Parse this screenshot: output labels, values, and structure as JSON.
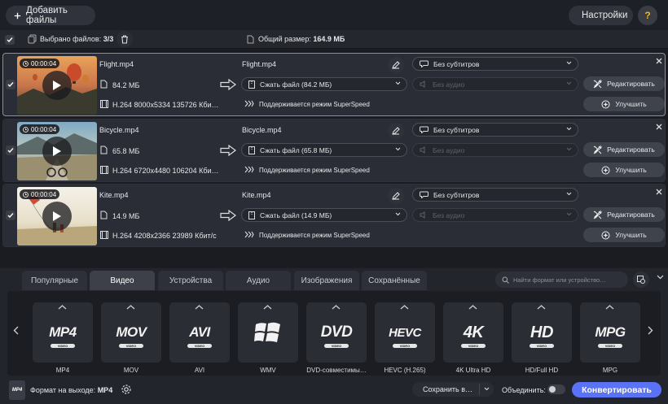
{
  "topbar": {
    "add_files_label": "Добавить файлы",
    "settings_label": "Настройки",
    "help_label": "?"
  },
  "selection": {
    "selected_label": "Выбрано файлов: ",
    "selected_count": "3/3",
    "total_label": "Общий размер: ",
    "total_size": "164.9 МБ"
  },
  "files": [
    {
      "duration": "00:00:04",
      "name": "Flight.mp4",
      "size": "84.2 МБ",
      "codec_info": "H.264 8000x5334 135726 Кби…",
      "output_name": "Flight.mp4",
      "compress": "Сжать файл (84.2 МБ)",
      "subtitles": "Без субтитров",
      "audio": "Без аудио",
      "superspeed": "Поддерживается режим SuperSpeed",
      "edit_label": "Редактировать",
      "enhance_label": "Улучшить"
    },
    {
      "duration": "00:00:04",
      "name": "Bicycle.mp4",
      "size": "65.8 МБ",
      "codec_info": "H.264 6720x4480 106204 Кби…",
      "output_name": "Bicycle.mp4",
      "compress": "Сжать файл (65.8 МБ)",
      "subtitles": "Без субтитров",
      "audio": "Без аудио",
      "superspeed": "Поддерживается режим SuperSpeed",
      "edit_label": "Редактировать",
      "enhance_label": "Улучшить"
    },
    {
      "duration": "00:00:04",
      "name": "Kite.mp4",
      "size": "14.9 МБ",
      "codec_info": "H.264 4208x2366 23989 Кбит/с",
      "output_name": "Kite.mp4",
      "compress": "Сжать файл (14.9 МБ)",
      "subtitles": "Без субтитров",
      "audio": "Без аудио",
      "superspeed": "Поддерживается режим SuperSpeed",
      "edit_label": "Редактировать",
      "enhance_label": "Улучшить"
    }
  ],
  "tabs": [
    "Популярные",
    "Видео",
    "Устройства",
    "Аудио",
    "Изображения",
    "Сохранённые"
  ],
  "active_tab": "Видео",
  "search": {
    "placeholder": "Найти формат или устройство…"
  },
  "formats": [
    {
      "logo": "MP4",
      "sub": "VIDEO",
      "caption": "MP4"
    },
    {
      "logo": "MOV",
      "sub": "VIDEO",
      "caption": "MOV"
    },
    {
      "logo": "AVI",
      "sub": "VIDEO",
      "caption": "AVI"
    },
    {
      "logo": "",
      "sub": "",
      "caption": "WMV"
    },
    {
      "logo": "DVD",
      "sub": "VIDEO",
      "caption": "DVD-совместимы…"
    },
    {
      "logo": "HEVC",
      "sub": "VIDEO",
      "caption": "HEVC (H.265)"
    },
    {
      "logo": "4K",
      "sub": "VIDEO",
      "caption": "4K Ultra HD"
    },
    {
      "logo": "HD",
      "sub": "VIDEO",
      "caption": "HD/Full HD"
    },
    {
      "logo": "MPG",
      "sub": "VIDEO",
      "caption": "MPG"
    }
  ],
  "footer": {
    "output_format_label": "Формат на выходе:",
    "output_format_value": "MP4",
    "format_icon_text": "MP4",
    "save_to_label": "Сохранить в…",
    "merge_label": "Объединить:",
    "convert_label": "Конвертировать"
  },
  "colors": {
    "accent": "#5a72f5",
    "background": "#1c1e24",
    "card": "#2a2d35"
  }
}
